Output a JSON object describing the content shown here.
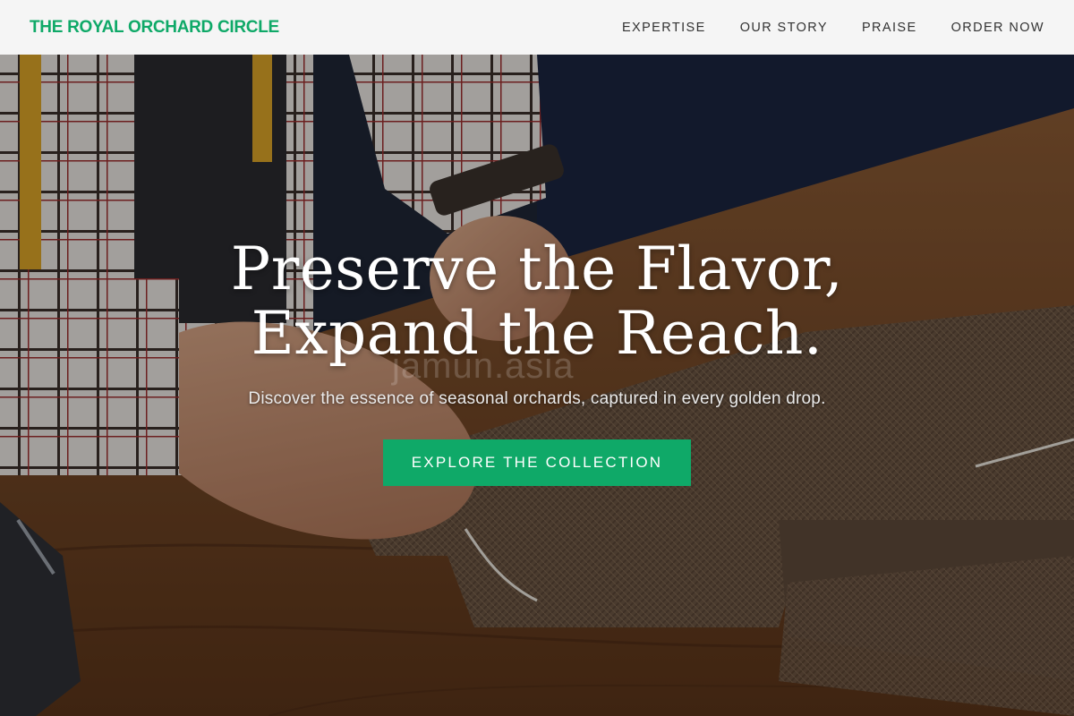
{
  "header": {
    "brand": "THE ROYAL ORCHARD CIRCLE",
    "nav": [
      {
        "label": "EXPERTISE"
      },
      {
        "label": "OUR STORY"
      },
      {
        "label": "PRAISE"
      },
      {
        "label": "ORDER NOW"
      }
    ]
  },
  "hero": {
    "title_line1": "Preserve the Flavor,",
    "title_line2": "Expand the Reach.",
    "subtitle": "Discover the essence of seasonal orchards, captured in every golden drop.",
    "cta_label": "EXPLORE THE COLLECTION",
    "watermark": "jamun.asia",
    "background_image": "tailor cutting brown tweed fabric on a wooden workbench"
  },
  "colors": {
    "accent": "#0fa968",
    "navbar_bg": "#f5f5f5",
    "nav_text": "#333333"
  }
}
